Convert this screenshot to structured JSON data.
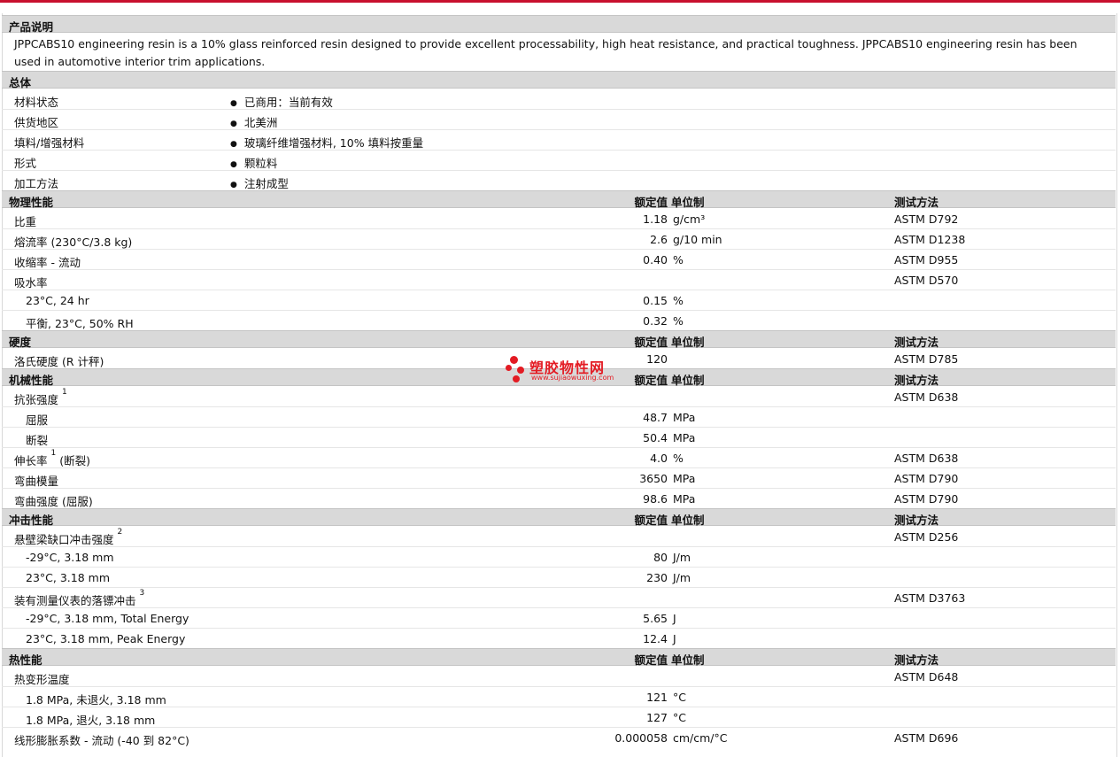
{
  "sections": {
    "desc": {
      "title": "产品说明",
      "text": "JPPCABS10 engineering resin is a 10% glass reinforced resin designed to provide excellent processability, high heat resistance, and practical toughness. JPPCABS10 engineering resin has been used in automotive interior trim applications."
    },
    "general": {
      "title": "总体",
      "rows": [
        {
          "label": "材料状态",
          "value": "已商用：当前有效"
        },
        {
          "label": "供货地区",
          "value": "北美洲"
        },
        {
          "label": "填料/增强材料",
          "value": "玻璃纤维增强材料, 10% 填料按重量"
        },
        {
          "label": "形式",
          "value": "颗粒料"
        },
        {
          "label": "加工方法",
          "value": "注射成型"
        }
      ]
    },
    "headers": {
      "value": "额定值",
      "unit": "单位制",
      "method": "测试方法"
    },
    "physical": {
      "title": "物理性能",
      "rows": [
        {
          "label": "比重",
          "value": "1.18",
          "unit": "g/cm³",
          "method": "ASTM D792"
        },
        {
          "label": "熔流率 (230°C/3.8 kg)",
          "value": "2.6",
          "unit": "g/10 min",
          "method": "ASTM D1238"
        },
        {
          "label": "收缩率 - 流动",
          "value": "0.40",
          "unit": "%",
          "method": "ASTM D955"
        },
        {
          "label": "吸水率",
          "value": "",
          "unit": "",
          "method": "ASTM D570"
        },
        {
          "label": "23°C, 24 hr",
          "value": "0.15",
          "unit": "%",
          "method": ""
        },
        {
          "label": "平衡, 23°C, 50% RH",
          "value": "0.32",
          "unit": "%",
          "method": ""
        }
      ]
    },
    "hardness": {
      "title": "硬度",
      "rows": [
        {
          "label": "洛氏硬度 (R 计秤)",
          "value": "120",
          "unit": "",
          "method": "ASTM D785"
        }
      ]
    },
    "mechanical": {
      "title": "机械性能",
      "rows": [
        {
          "label": "抗张强度",
          "sup": "1",
          "value": "",
          "unit": "",
          "method": "ASTM D638"
        },
        {
          "label": "屈服",
          "value": "48.7",
          "unit": "MPa",
          "method": ""
        },
        {
          "label": "断裂",
          "value": "50.4",
          "unit": "MPa",
          "method": ""
        },
        {
          "label": "伸长率",
          "sup": "1",
          "suffix": "(断裂)",
          "value": "4.0",
          "unit": "%",
          "method": "ASTM D638"
        },
        {
          "label": "弯曲模量",
          "value": "3650",
          "unit": "MPa",
          "method": "ASTM D790"
        },
        {
          "label": "弯曲强度 (屈服)",
          "value": "98.6",
          "unit": "MPa",
          "method": "ASTM D790"
        }
      ]
    },
    "impact": {
      "title": "冲击性能",
      "rows": [
        {
          "label": "悬壁梁缺口冲击强度",
          "sup": "2",
          "value": "",
          "unit": "",
          "method": "ASTM D256"
        },
        {
          "label": "-29°C, 3.18 mm",
          "value": "80",
          "unit": "J/m",
          "method": ""
        },
        {
          "label": "23°C, 3.18 mm",
          "value": "230",
          "unit": "J/m",
          "method": ""
        },
        {
          "label": "装有测量仪表的落镖冲击",
          "sup": "3",
          "value": "",
          "unit": "",
          "method": "ASTM D3763"
        },
        {
          "label": "-29°C, 3.18 mm, Total Energy",
          "value": "5.65",
          "unit": "J",
          "method": ""
        },
        {
          "label": "23°C, 3.18 mm, Peak Energy",
          "value": "12.4",
          "unit": "J",
          "method": ""
        }
      ]
    },
    "thermal": {
      "title": "热性能",
      "rows": [
        {
          "label": "热变形温度",
          "value": "",
          "unit": "",
          "method": "ASTM D648"
        },
        {
          "label": "1.8 MPa, 未退火, 3.18 mm",
          "value": "121",
          "unit": "°C",
          "method": ""
        },
        {
          "label": "1.8 MPa, 退火, 3.18 mm",
          "value": "127",
          "unit": "°C",
          "method": ""
        },
        {
          "label": "线形膨胀系数 - 流动 (-40 到 82°C)",
          "value": "0.000058",
          "unit": "cm/cm/°C",
          "method": "ASTM D696"
        }
      ]
    }
  },
  "watermark": {
    "name": "塑胶物性网",
    "url": "www.sujiaowuxing.com"
  },
  "colors": {
    "accent": "#c8102e",
    "header_bg": "#d9d9d9",
    "watermark": "#e31b23"
  }
}
